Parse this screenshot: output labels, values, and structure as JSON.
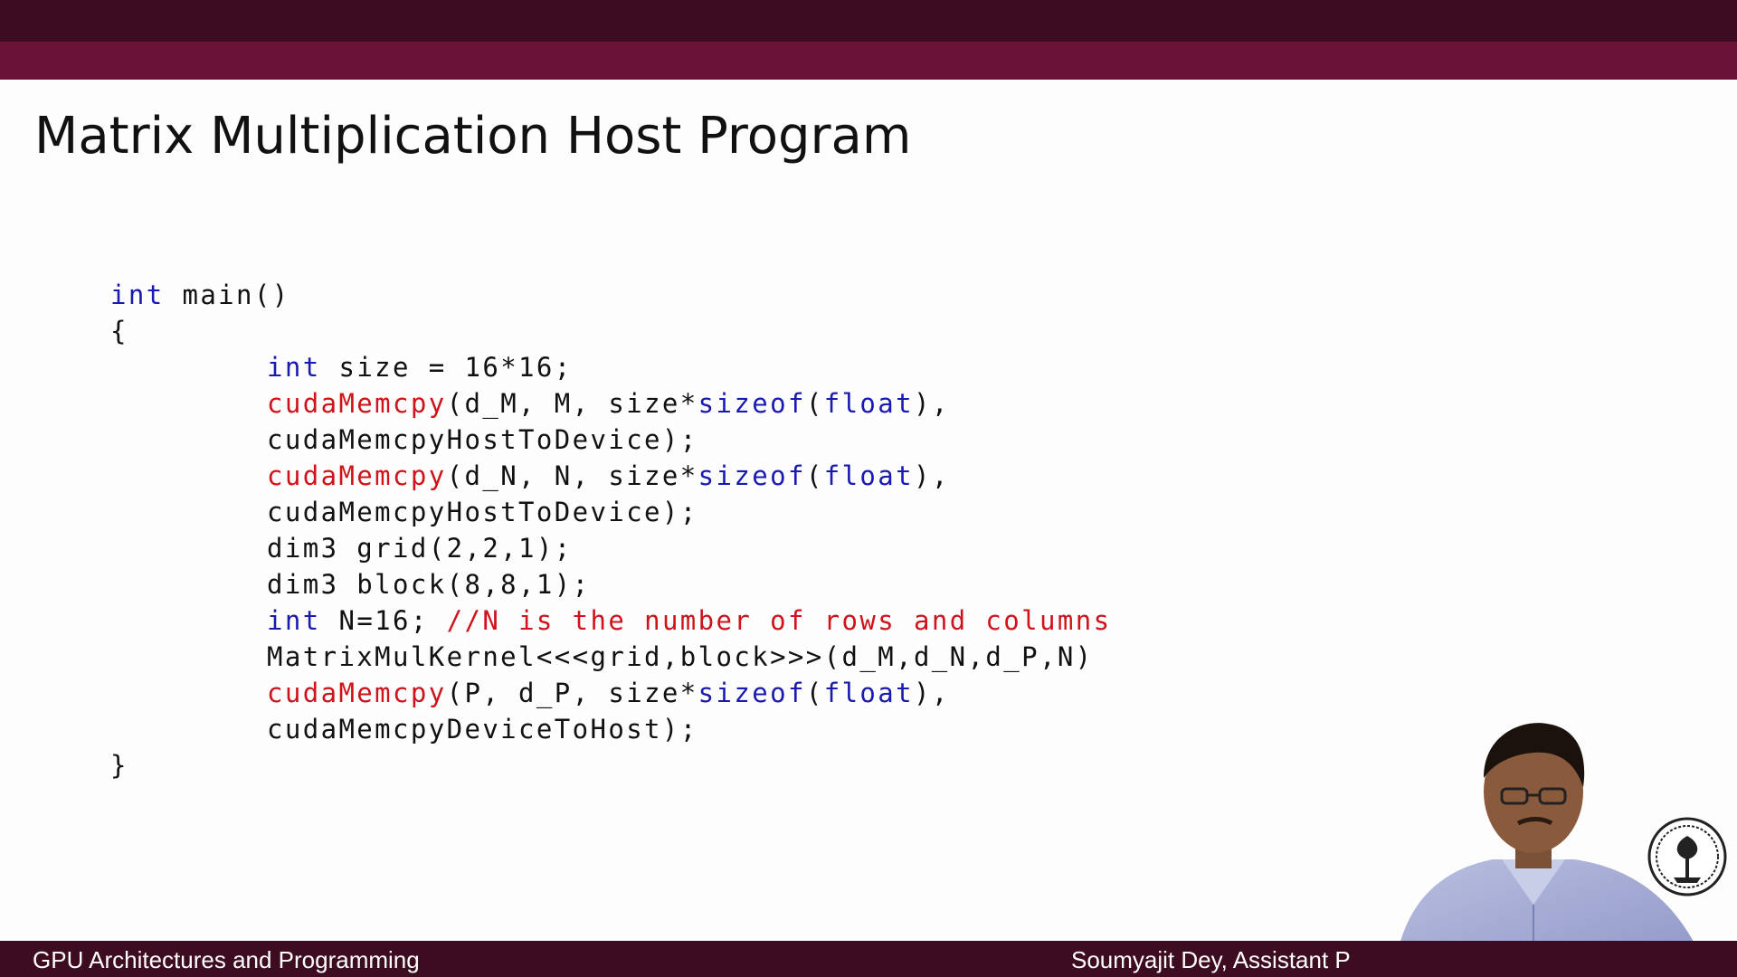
{
  "slide": {
    "title": "Matrix Multiplication Host Program",
    "footer_left": "GPU Architectures and Programming",
    "footer_right": "Soumyajit Dey, Assistant P"
  },
  "code": {
    "l1_kw": "int",
    "l1_rest": " main()",
    "l2": "{",
    "l3_kw": "int",
    "l3_rest": " size = 16*16;",
    "l4_fn": "cudaMemcpy",
    "l4_a": "(d_M, M, size*",
    "l4_kw1": "sizeof",
    "l4_b": "(",
    "l4_kw2": "float",
    "l4_c": "),",
    "l5": "cudaMemcpyHostToDevice);",
    "l6_fn": "cudaMemcpy",
    "l6_a": "(d_N, N, size*",
    "l6_kw1": "sizeof",
    "l6_b": "(",
    "l6_kw2": "float",
    "l6_c": "),",
    "l7": "cudaMemcpyHostToDevice);",
    "l8": "dim3 grid(2,2,1);",
    "l9": "dim3 block(8,8,1);",
    "l10_kw": "int",
    "l10_rest": " N=16; ",
    "l10_cm": "//N is the number of rows and columns",
    "l11": "MatrixMulKernel<<<grid,block>>>(d_M,d_N,d_P,N)",
    "l12_fn": "cudaMemcpy",
    "l12_a": "(P, d_P, size*",
    "l12_kw1": "sizeof",
    "l12_b": "(",
    "l12_kw2": "float",
    "l12_c": "),",
    "l13": "cudaMemcpyDeviceToHost);",
    "l14": "}"
  },
  "colors": {
    "header_dark": "#3d0c20",
    "header_mid": "#6a1238",
    "keyword": "#1a1ab0",
    "function": "#d0121b",
    "comment": "#d0121b"
  },
  "icons": {
    "logo": "institute-seal-icon",
    "presenter": "presenter-video"
  }
}
